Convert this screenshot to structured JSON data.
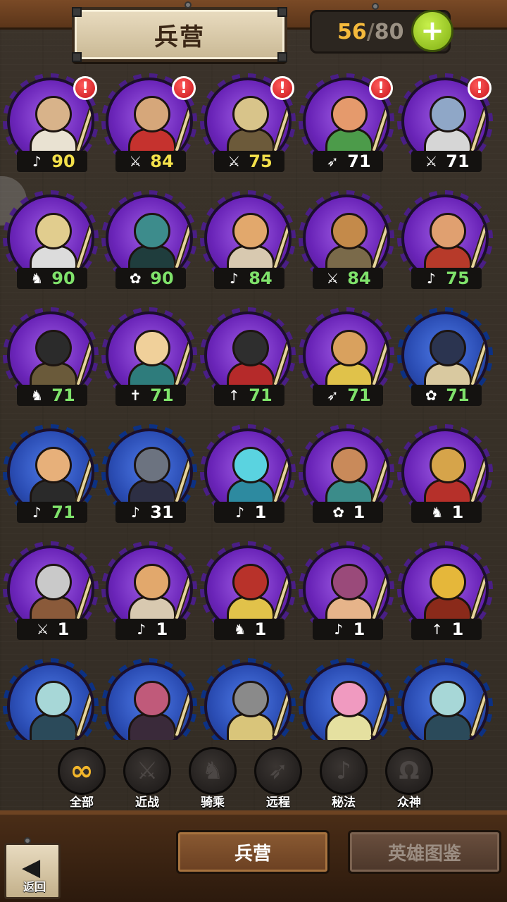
{
  "header": {
    "title": "兵营",
    "capacity_current": "56",
    "capacity_sep": "/",
    "capacity_max": "80",
    "add_symbol": "+"
  },
  "units": [
    {
      "hero": "white-bearded-bishop",
      "class_icon": "magic",
      "level": "90",
      "color": "yellow",
      "alert": true,
      "frame": "purple",
      "palette": [
        "#d8b38a",
        "#e9e2d2"
      ]
    },
    {
      "hero": "monkey-king-warrior",
      "class_icon": "melee",
      "level": "84",
      "color": "yellow",
      "alert": true,
      "frame": "purple",
      "palette": [
        "#d6a77a",
        "#c5322e"
      ]
    },
    {
      "hero": "gold-helmet-soldier",
      "class_icon": "melee",
      "level": "75",
      "color": "yellow",
      "alert": true,
      "frame": "purple",
      "palette": [
        "#d8c48a",
        "#6c5a3a"
      ]
    },
    {
      "hero": "elf-archer-girl",
      "class_icon": "ranged",
      "level": "71",
      "color": "white",
      "alert": true,
      "frame": "purple",
      "palette": [
        "#e59a6c",
        "#4c9b4a"
      ]
    },
    {
      "hero": "cyclops-blue-brute",
      "class_icon": "melee",
      "level": "71",
      "color": "white",
      "alert": true,
      "frame": "purple",
      "palette": [
        "#8fa7c7",
        "#d6d6d6"
      ]
    },
    {
      "hero": "gold-armored-knight-horse",
      "class_icon": "mounted",
      "level": "90",
      "color": "green",
      "alert": false,
      "frame": "purple",
      "palette": [
        "#e1cd8e",
        "#dcdcdc"
      ]
    },
    {
      "hero": "antlered-druid-rider",
      "class_icon": "divine",
      "level": "90",
      "color": "green",
      "alert": false,
      "frame": "purple",
      "palette": [
        "#3d8c8c",
        "#1f3d3d"
      ]
    },
    {
      "hero": "pharaoh-priest",
      "class_icon": "magic",
      "level": "84",
      "color": "green",
      "alert": false,
      "frame": "purple",
      "palette": [
        "#e2a86c",
        "#d8c9b0"
      ]
    },
    {
      "hero": "dwarf-gold-warrior",
      "class_icon": "melee",
      "level": "84",
      "color": "green",
      "alert": false,
      "frame": "purple",
      "palette": [
        "#c48a4a",
        "#7a6a4a"
      ]
    },
    {
      "hero": "red-haired-sun-mage",
      "class_icon": "magic",
      "level": "75",
      "color": "green",
      "alert": false,
      "frame": "purple",
      "palette": [
        "#e0a070",
        "#b73a2a"
      ]
    },
    {
      "hero": "black-knight-horse",
      "class_icon": "mounted",
      "level": "71",
      "color": "green",
      "alert": false,
      "frame": "purple",
      "palette": [
        "#2b2b2b",
        "#6a5a3a"
      ]
    },
    {
      "hero": "elf-cleric-girl",
      "class_icon": "support",
      "level": "71",
      "color": "green",
      "alert": false,
      "frame": "purple",
      "palette": [
        "#f0d09a",
        "#2e7c7c"
      ]
    },
    {
      "hero": "masked-ninja-sword",
      "class_icon": "dagger",
      "level": "71",
      "color": "green",
      "alert": false,
      "frame": "purple",
      "palette": [
        "#2e2e2e",
        "#b52a2a"
      ]
    },
    {
      "hero": "golden-amazon-archer",
      "class_icon": "ranged",
      "level": "71",
      "color": "green",
      "alert": false,
      "frame": "purple",
      "palette": [
        "#d9a15e",
        "#e0c24a"
      ]
    },
    {
      "hero": "horned-dark-knight",
      "class_icon": "divine",
      "level": "71",
      "color": "green",
      "alert": false,
      "frame": "blue",
      "palette": [
        "#2b3450",
        "#d9c9a0"
      ]
    },
    {
      "hero": "egyptian-priestess",
      "class_icon": "magic",
      "level": "71",
      "color": "green",
      "alert": false,
      "frame": "blue",
      "palette": [
        "#e7b07a",
        "#2a2a2a"
      ]
    },
    {
      "hero": "wolf-sorcerer",
      "class_icon": "magic",
      "level": "31",
      "color": "white",
      "alert": false,
      "frame": "blue",
      "palette": [
        "#6c7380",
        "#2d2f44"
      ]
    },
    {
      "hero": "ghost-wisp-girl",
      "class_icon": "magic",
      "level": "1",
      "color": "white",
      "alert": false,
      "frame": "purple",
      "palette": [
        "#5ad3e0",
        "#2d8aa0"
      ]
    },
    {
      "hero": "antlered-forest-druid",
      "class_icon": "divine",
      "level": "1",
      "color": "white",
      "alert": false,
      "frame": "purple",
      "palette": [
        "#c98a5a",
        "#3b8c8a"
      ]
    },
    {
      "hero": "spartan-lion-rider",
      "class_icon": "mounted",
      "level": "1",
      "color": "white",
      "alert": false,
      "frame": "purple",
      "palette": [
        "#d6a44a",
        "#b6302a"
      ]
    },
    {
      "hero": "viking-axe-warrior",
      "class_icon": "melee",
      "level": "1",
      "color": "white",
      "alert": false,
      "frame": "purple",
      "palette": [
        "#c9c9c9",
        "#8a5a3a"
      ]
    },
    {
      "hero": "pharaoh-priest-2",
      "class_icon": "magic",
      "level": "1",
      "color": "white",
      "alert": false,
      "frame": "purple",
      "palette": [
        "#e2a86c",
        "#d8c9b0"
      ]
    },
    {
      "hero": "crowned-king-rider",
      "class_icon": "mounted",
      "level": "1",
      "color": "white",
      "alert": false,
      "frame": "purple",
      "palette": [
        "#b8322a",
        "#e1c24a"
      ]
    },
    {
      "hero": "hooded-rogue-girl",
      "class_icon": "magic",
      "level": "1",
      "color": "white",
      "alert": false,
      "frame": "purple",
      "palette": [
        "#9a4a7a",
        "#e6b48a"
      ]
    },
    {
      "hero": "golden-helm-bird",
      "class_icon": "dagger",
      "level": "1",
      "color": "white",
      "alert": false,
      "frame": "purple",
      "palette": [
        "#e5b73a",
        "#8a2a1a"
      ]
    },
    {
      "hero": "elf-hooded-archer",
      "class_icon": "",
      "level": "",
      "color": "white",
      "alert": false,
      "frame": "blue",
      "palette": [
        "#a7d7d7",
        "#2b4a5a"
      ]
    },
    {
      "hero": "pink-haired-witch",
      "class_icon": "",
      "level": "",
      "color": "white",
      "alert": false,
      "frame": "blue",
      "palette": [
        "#c05a7a",
        "#3a2a3a"
      ]
    },
    {
      "hero": "armored-cavalier",
      "class_icon": "",
      "level": "",
      "color": "white",
      "alert": false,
      "frame": "blue",
      "palette": [
        "#8a8a8a",
        "#d9c57a"
      ]
    },
    {
      "hero": "unicorn-horn-girl",
      "class_icon": "",
      "level": "",
      "color": "white",
      "alert": false,
      "frame": "blue",
      "palette": [
        "#f09ac0",
        "#e5e0a0"
      ]
    },
    {
      "hero": "elf-hooded-archer-2",
      "class_icon": "",
      "level": "",
      "color": "white",
      "alert": false,
      "frame": "blue",
      "palette": [
        "#a7d7d7",
        "#2b4a5a"
      ]
    }
  ],
  "class_glyphs": {
    "magic": "♪",
    "melee": "⚔",
    "ranged": "➶",
    "mounted": "♞",
    "divine": "✿",
    "support": "✝",
    "dagger": "↑"
  },
  "filters": [
    {
      "key": "all",
      "label": "全部",
      "glyph": "∞",
      "active": true
    },
    {
      "key": "melee",
      "label": "近战",
      "glyph": "⚔",
      "active": false
    },
    {
      "key": "mounted",
      "label": "骑乘",
      "glyph": "♞",
      "active": false
    },
    {
      "key": "ranged",
      "label": "远程",
      "glyph": "➶",
      "active": false
    },
    {
      "key": "magic",
      "label": "秘法",
      "glyph": "♪",
      "active": false
    },
    {
      "key": "gods",
      "label": "众神",
      "glyph": "Ω",
      "active": false
    }
  ],
  "footer": {
    "back_label": "返回",
    "back_glyph": "◀",
    "tab_barracks": "兵营",
    "tab_codex": "英雄图鉴"
  }
}
